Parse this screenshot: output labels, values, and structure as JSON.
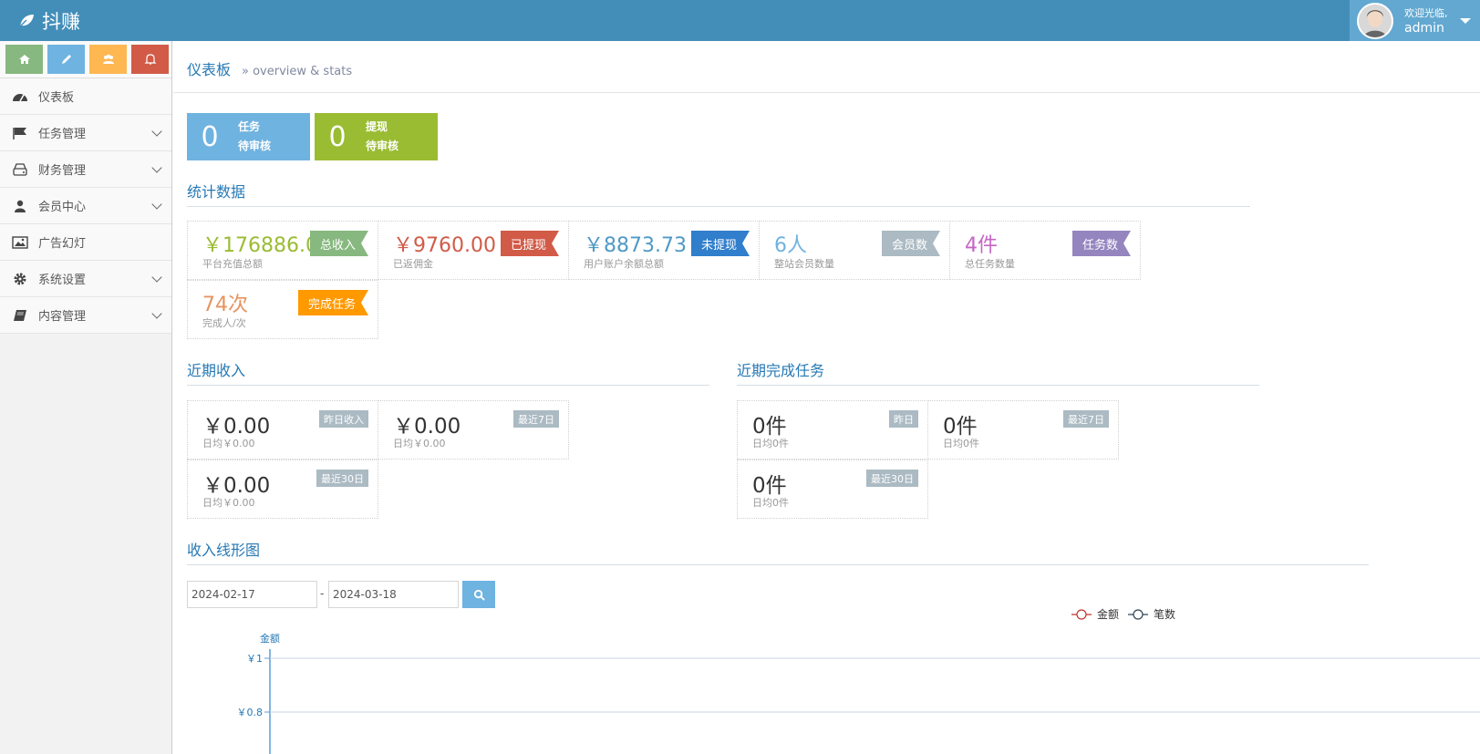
{
  "app": {
    "title": "抖赚"
  },
  "user": {
    "welcome": "欢迎光临,",
    "name": "admin"
  },
  "colors": {
    "navbar": "#438eb9",
    "user_box": "#62a8d1",
    "accent_blue": "#2679b5"
  },
  "shortcuts": [
    {
      "icon": "home-icon",
      "color": "#87b87f"
    },
    {
      "icon": "pencil-icon",
      "color": "#6fb3e0"
    },
    {
      "icon": "users-icon",
      "color": "#ffb752"
    },
    {
      "icon": "bell-icon",
      "color": "#d15b47"
    }
  ],
  "sidebar": {
    "items": [
      {
        "label": "仪表板",
        "icon": "dashboard-icon",
        "expandable": false
      },
      {
        "label": "任务管理",
        "icon": "flag-icon",
        "expandable": true
      },
      {
        "label": "财务管理",
        "icon": "hdd-icon",
        "expandable": true
      },
      {
        "label": "会员中心",
        "icon": "user-icon",
        "expandable": true
      },
      {
        "label": "广告幻灯",
        "icon": "picture-icon",
        "expandable": false
      },
      {
        "label": "系统设置",
        "icon": "cog-icon",
        "expandable": true
      },
      {
        "label": "内容管理",
        "icon": "book-icon",
        "expandable": true
      }
    ]
  },
  "page": {
    "title": "仪表板",
    "subtitle": "» overview & stats"
  },
  "pending": [
    {
      "count": "0",
      "line1": "任务",
      "line2": "待审核",
      "color": "#6fb3e0"
    },
    {
      "count": "0",
      "line1": "提现",
      "line2": "待审核",
      "color": "#9abc32"
    }
  ],
  "stats": {
    "title": "统计数据",
    "items": [
      {
        "value": "￥176886.00",
        "desc": "平台充值总额",
        "tag": "总收入",
        "value_color": "#9abc32",
        "tag_color": "#87b87f"
      },
      {
        "value": "￥9760.00",
        "desc": "已返佣金",
        "tag": "已提现",
        "value_color": "#d15b47",
        "tag_color": "#d15b47"
      },
      {
        "value": "￥8873.73",
        "desc": "用户账户余额总额",
        "tag": "未提现",
        "value_color": "#4f99c6",
        "tag_color": "#307ecc"
      },
      {
        "value": "6人",
        "desc": "整站会员数量",
        "tag": "会员数",
        "value_color": "#6fb3e0",
        "tag_color": "#abbac3"
      },
      {
        "value": "4件",
        "desc": "总任务数量",
        "tag": "任务数",
        "value_color": "#c565c5",
        "tag_color": "#9585bf"
      },
      {
        "value": "74次",
        "desc": "完成人/次",
        "tag": "完成任务",
        "value_color": "#e8935f",
        "tag_color": "#ff9900"
      }
    ]
  },
  "recent_income": {
    "title": "近期收入",
    "items": [
      {
        "value": "￥0.00",
        "desc": "日均￥0.00",
        "badge": "昨日收入"
      },
      {
        "value": "￥0.00",
        "desc": "日均￥0.00",
        "badge": "最近7日"
      },
      {
        "value": "￥0.00",
        "desc": "日均￥0.00",
        "badge": "最近30日"
      }
    ]
  },
  "recent_tasks": {
    "title": "近期完成任务",
    "items": [
      {
        "value": "0件",
        "desc": "日均0件",
        "badge": "昨日"
      },
      {
        "value": "0件",
        "desc": "日均0件",
        "badge": "最近7日"
      },
      {
        "value": "0件",
        "desc": "日均0件",
        "badge": "最近30日"
      }
    ]
  },
  "income_chart": {
    "title": "收入线形图",
    "date_from": "2024-02-17",
    "date_sep": "-",
    "date_to": "2024-03-18"
  },
  "chart_data": {
    "type": "line",
    "ylabel": "金额",
    "series": [
      {
        "name": "金额",
        "color": "#c23531",
        "values": []
      },
      {
        "name": "笔数",
        "color": "#2f4554",
        "values": []
      }
    ],
    "yticks": [
      "￥1",
      "￥0.8"
    ],
    "legend": "top-right"
  }
}
